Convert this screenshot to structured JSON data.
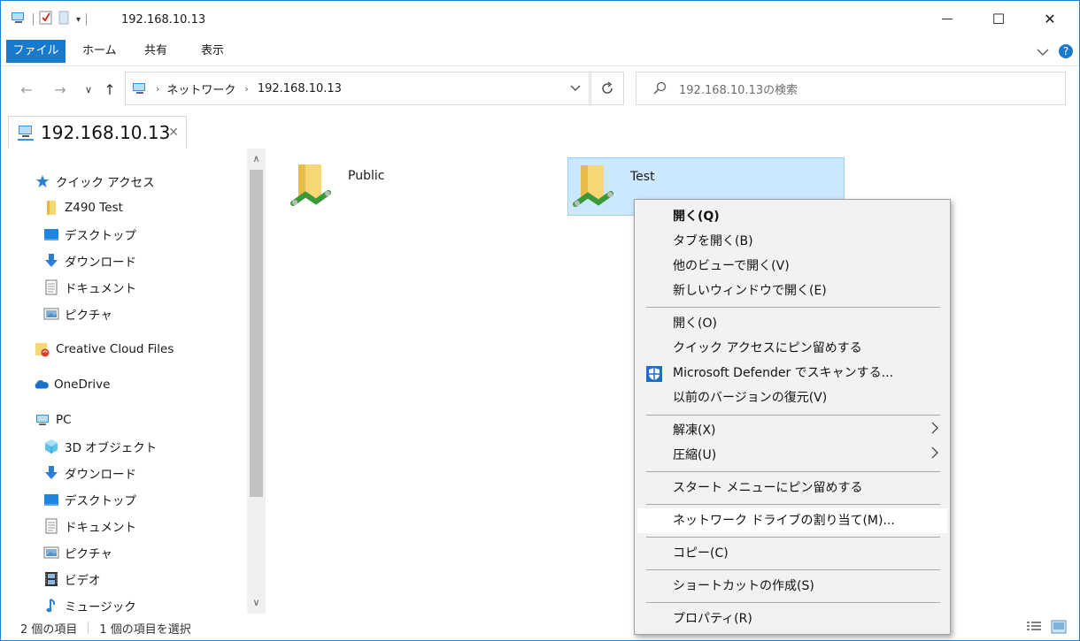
{
  "window": {
    "title": "192.168.10.13",
    "minimize_glyph": "—",
    "maximize_glyph": "☐",
    "close_glyph": "✕"
  },
  "ribbon": {
    "tabs": [
      "ファイル",
      "ホーム",
      "共有",
      "表示"
    ]
  },
  "address": {
    "segments": [
      "ネットワーク",
      "192.168.10.13"
    ]
  },
  "search": {
    "placeholder": "192.168.10.13の検索"
  },
  "tab": {
    "label": "192.168.10.13"
  },
  "nav": {
    "quick_access": "クイック アクセス",
    "pinned": [
      "Z490 Test",
      "デスクトップ",
      "ダウンロード",
      "ドキュメント",
      "ピクチャ"
    ],
    "creative_cloud": "Creative Cloud Files",
    "onedrive": "OneDrive",
    "pc": "PC",
    "pc_items": [
      "3D オブジェクト",
      "ダウンロード",
      "デスクトップ",
      "ドキュメント",
      "ピクチャ",
      "ビデオ",
      "ミュージック"
    ]
  },
  "content": {
    "items": [
      {
        "name": "Public",
        "selected": false
      },
      {
        "name": "Test",
        "selected": true
      }
    ]
  },
  "status": {
    "count": "2 個の項目",
    "selected": "1 個の項目を選択"
  },
  "context_menu": {
    "items": [
      "開く(Q)",
      "タブを開く(B)",
      "他のビューで開く(V)",
      "新しいウィンドウで開く(E)",
      "開く(O)",
      "クイック アクセスにピン留めする",
      "Microsoft Defender でスキャンする...",
      "以前のバージョンの復元(V)",
      "解凍(X)",
      "圧縮(U)",
      "スタート メニューにピン留めする",
      "ネットワーク ドライブの割り当て(M)...",
      "コピー(C)",
      "ショートカットの作成(S)",
      "プロパティ(R)"
    ]
  },
  "colors": {
    "accent": "#1979ca",
    "selection_bg": "#cce8ff",
    "menu_bg": "#f2f2f2"
  }
}
